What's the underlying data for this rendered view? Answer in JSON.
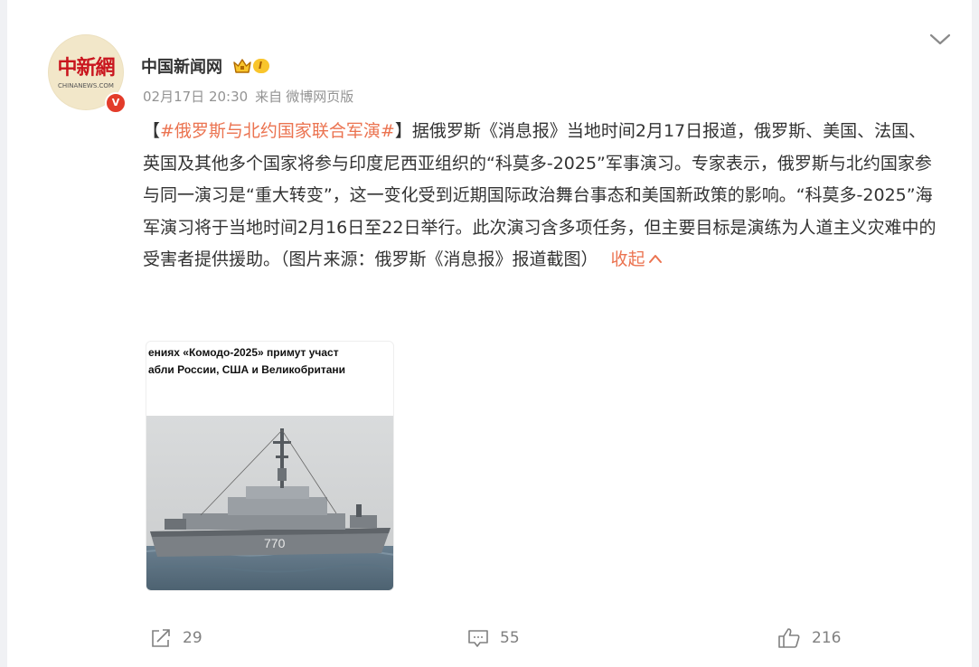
{
  "author": {
    "name": "中国新闻网",
    "avatar_text": "中新網",
    "avatar_subtext": "CHINANEWS.COM",
    "verified_badge": "V",
    "level_badge": "I"
  },
  "meta": {
    "time": "02月17日 20:30",
    "source_prefix": "来自",
    "source": "微博网页版"
  },
  "post": {
    "bracket_open": "【",
    "hashtag": "#俄罗斯与北约国家联合军演#",
    "bracket_close": "】",
    "body": "据俄罗斯《消息报》当地时间2月17日报道，俄罗斯、美国、法国、英国及其他多个国家将参与印度尼西亚组织的“科莫多-2025”军事演习。专家表示，俄罗斯与北约国家参与同一演习是“重大转变”，这一变化受到近期国际政治舞台事态和美国新政策的影响。“科莫多-2025”海军演习将于当地时间2月16日至22日举行。此次演习含多项任务，但主要目标是演练为人道主义灾难中的受害者提供援助。（图片来源：俄罗斯《消息报》报道截图）",
    "collapse_label": "收起",
    "collapse_icon": "chevron-up-icon"
  },
  "image": {
    "headline_line1": "ениях «Комодо-2025» примут участ",
    "headline_line2": "абли России, США и Великобритани",
    "hull_number": "770"
  },
  "actions": {
    "repost_count": "29",
    "comment_count": "55",
    "like_count": "216"
  },
  "colors": {
    "accent": "#eb7350",
    "text": "#333333",
    "meta": "#939393",
    "background": "#f0f1f4"
  }
}
